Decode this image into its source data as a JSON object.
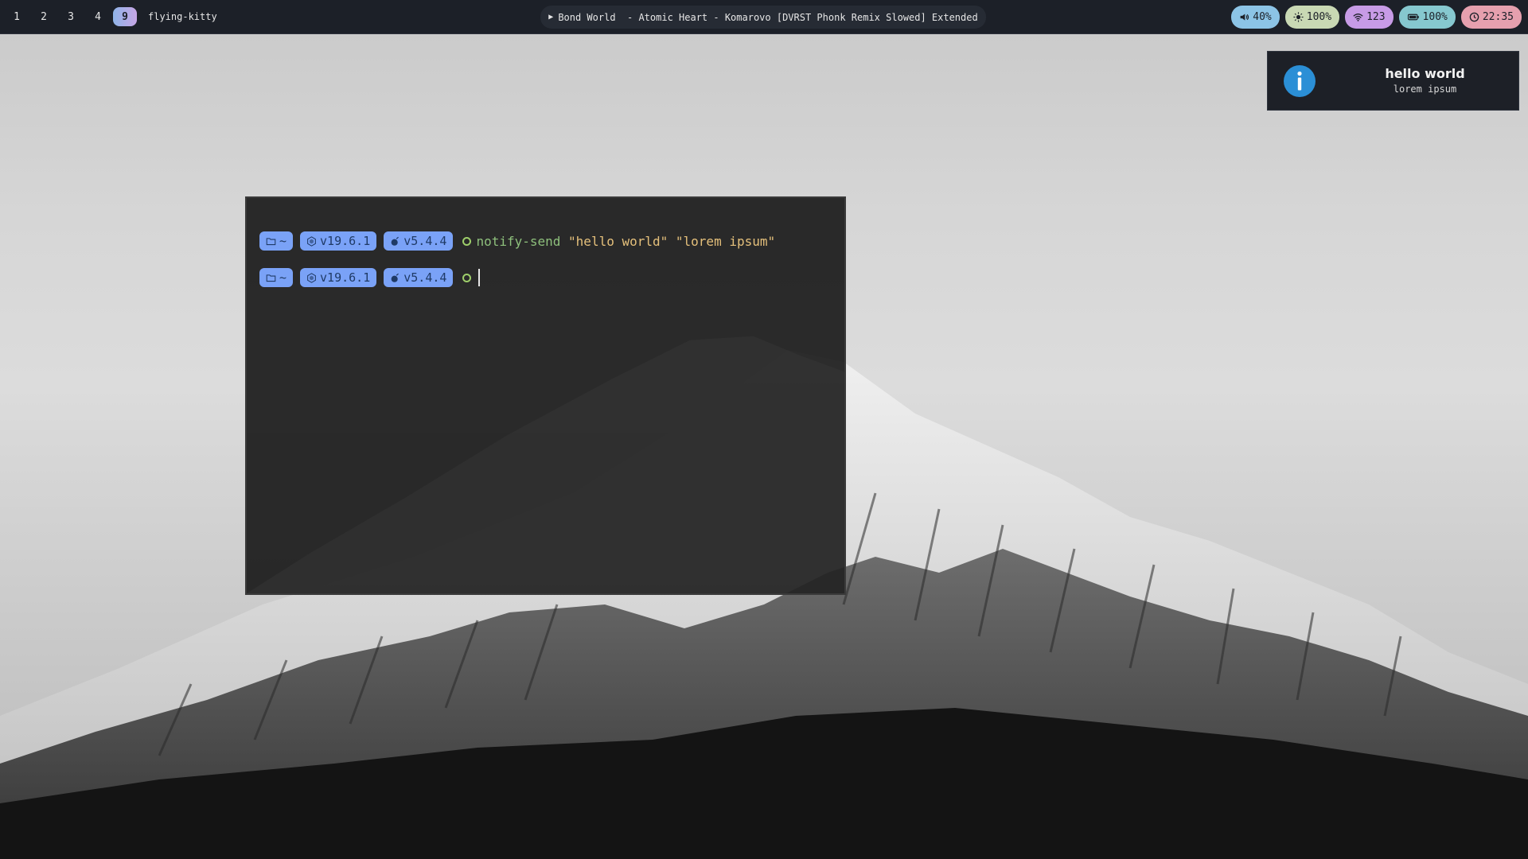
{
  "workspaces": [
    "1",
    "2",
    "3",
    "4",
    "9"
  ],
  "active_workspace": "9",
  "window_title": "flying-kitty",
  "media": {
    "icon": "play-icon",
    "text": "Bond World  - Atomic Heart - Komarovo [DVRST Phonk Remix Slowed] Extended"
  },
  "modules": {
    "volume": "40%",
    "brightness": "100%",
    "network": "123",
    "battery": "100%",
    "clock": "22:35"
  },
  "notification": {
    "icon": "info-icon",
    "title": "hello world",
    "body": "lorem ipsum"
  },
  "terminal": {
    "prompt": {
      "dir": "~",
      "node_version": "v19.6.1",
      "bun_version": "v5.4.4"
    },
    "history": {
      "command": "notify-send",
      "args": " \"hello world\" \"lorem ipsum\""
    }
  },
  "colors": {
    "bar_bg": "#1c2028",
    "pill": "#7aa2f7",
    "ok_green": "#9ece6a"
  }
}
